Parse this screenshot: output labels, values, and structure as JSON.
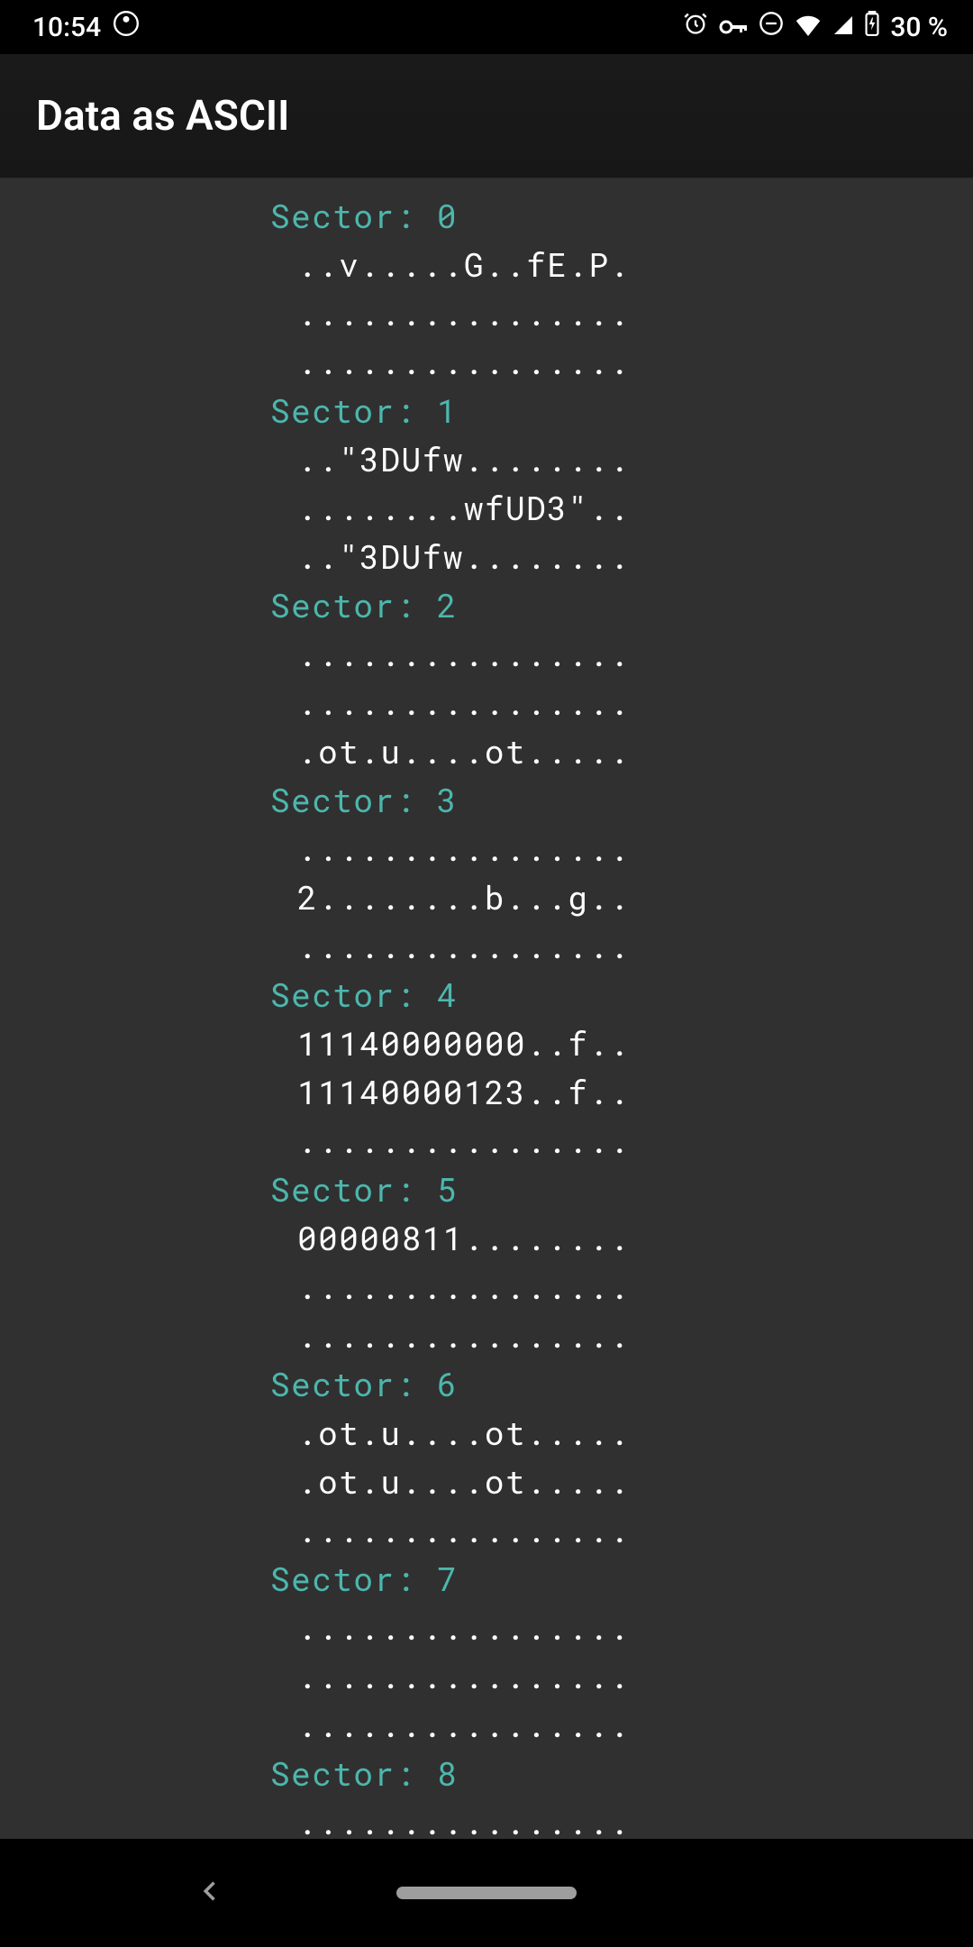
{
  "status": {
    "time": "10:54",
    "battery": "30 %"
  },
  "app_bar": {
    "title": "Data as ASCII"
  },
  "sectors": [
    {
      "header": "Sector: 0",
      "lines": [
        "..v.....G..fE.P.",
        "................",
        "................"
      ]
    },
    {
      "header": "Sector: 1",
      "lines": [
        "..\"3DUfw........",
        "........wfUD3\"..",
        "..\"3DUfw........"
      ]
    },
    {
      "header": "Sector: 2",
      "lines": [
        "................",
        "................",
        ".ot.u....ot....."
      ]
    },
    {
      "header": "Sector: 3",
      "lines": [
        "................",
        "2........b...g..",
        "................"
      ]
    },
    {
      "header": "Sector: 4",
      "lines": [
        "11140000000..f..",
        "11140000123..f..",
        "................"
      ]
    },
    {
      "header": "Sector: 5",
      "lines": [
        "00000811........",
        "................",
        "................"
      ]
    },
    {
      "header": "Sector: 6",
      "lines": [
        ".ot.u....ot.....",
        ".ot.u....ot.....",
        "................"
      ]
    },
    {
      "header": "Sector: 7",
      "lines": [
        "................",
        "................",
        "................"
      ]
    },
    {
      "header": "Sector: 8",
      "lines": [
        "................"
      ]
    }
  ]
}
